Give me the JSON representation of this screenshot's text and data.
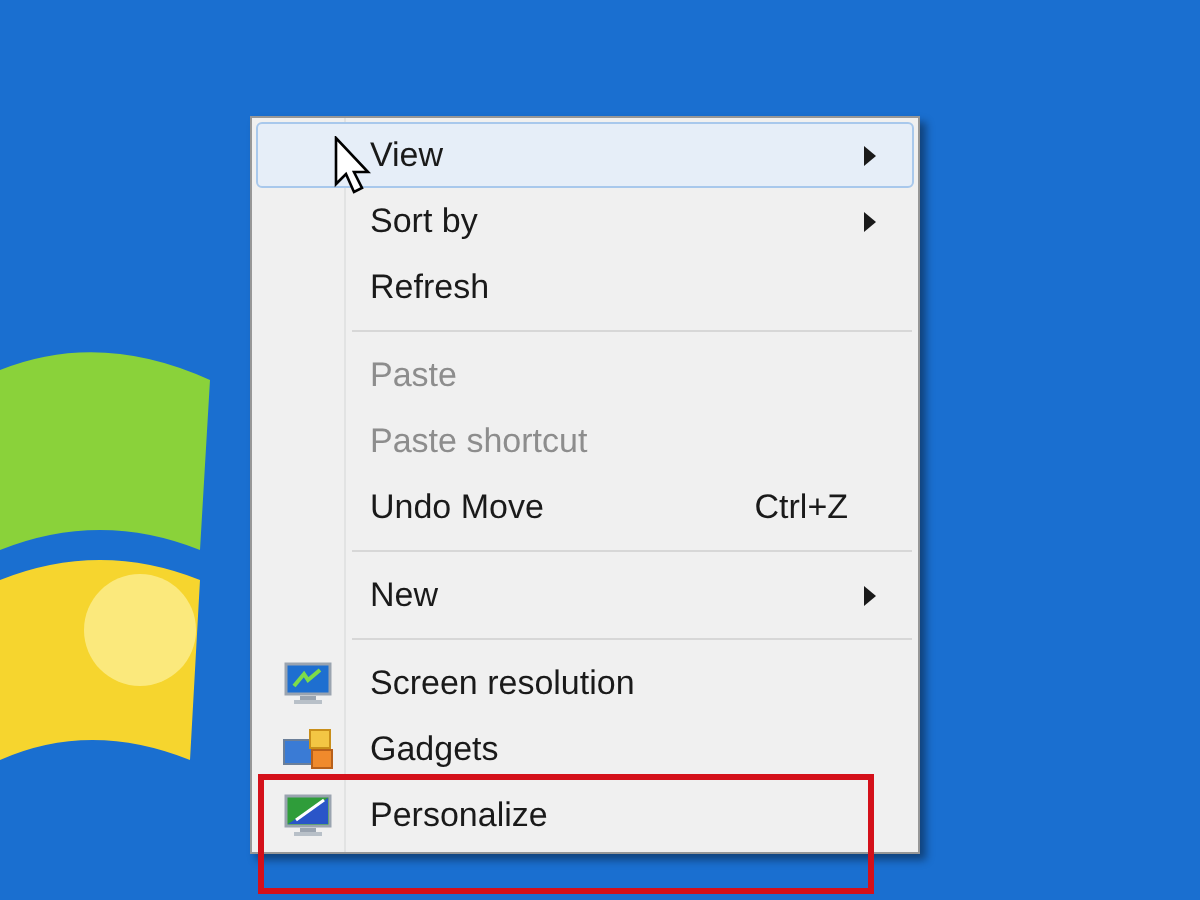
{
  "context_menu": {
    "groups": [
      {
        "items": [
          {
            "label": "View",
            "submenu": true,
            "disabled": false,
            "selected": true,
            "kind": "plain",
            "annotated": false
          },
          {
            "label": "Sort by",
            "submenu": true,
            "disabled": false,
            "selected": false,
            "kind": "plain",
            "annotated": false
          },
          {
            "label": "Refresh",
            "submenu": false,
            "disabled": false,
            "selected": false,
            "kind": "plain",
            "annotated": false
          }
        ]
      },
      {
        "items": [
          {
            "label": "Paste",
            "submenu": false,
            "disabled": true,
            "selected": false,
            "kind": "plain",
            "annotated": false
          },
          {
            "label": "Paste shortcut",
            "submenu": false,
            "disabled": true,
            "selected": false,
            "kind": "plain",
            "annotated": false
          },
          {
            "label": "Undo Move",
            "shortcut": "Ctrl+Z",
            "submenu": false,
            "disabled": false,
            "selected": false,
            "kind": "plain",
            "annotated": false
          }
        ]
      },
      {
        "items": [
          {
            "label": "New",
            "submenu": true,
            "disabled": false,
            "selected": false,
            "kind": "plain",
            "annotated": false
          }
        ]
      },
      {
        "items": [
          {
            "label": "Screen resolution",
            "submenu": false,
            "disabled": false,
            "selected": false,
            "kind": "display",
            "annotated": false
          },
          {
            "label": "Gadgets",
            "submenu": false,
            "disabled": false,
            "selected": false,
            "kind": "gadgets",
            "annotated": false
          },
          {
            "label": "Personalize",
            "submenu": false,
            "disabled": false,
            "selected": false,
            "kind": "personalize",
            "annotated": true
          }
        ]
      }
    ]
  }
}
